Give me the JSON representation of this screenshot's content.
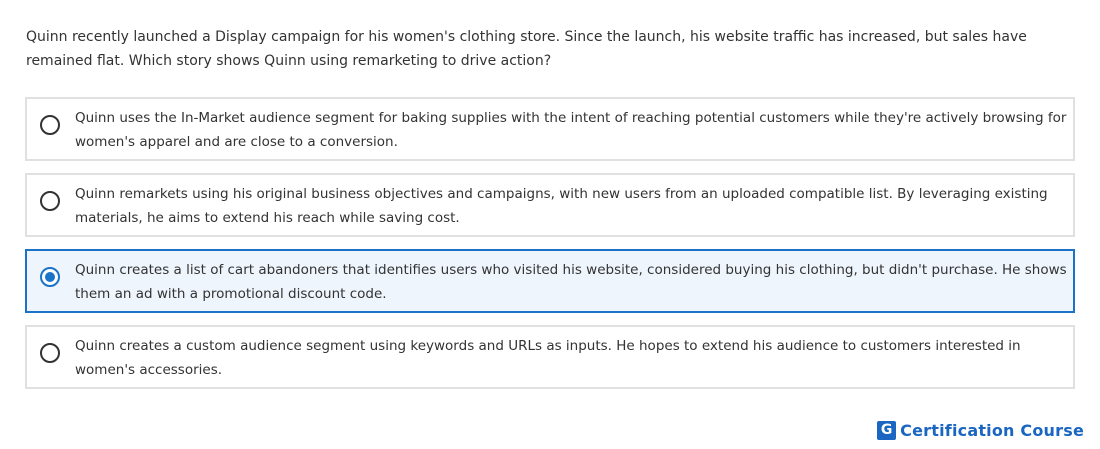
{
  "question": {
    "text": "Quinn recently launched a Display campaign for his women's clothing store. Since the launch, his website traffic has increased, but sales have remained flat. Which story shows Quinn using remarketing to drive action?"
  },
  "options": [
    {
      "text": "Quinn uses the In-Market audience segment for baking supplies with the intent of reaching potential customers while they're actively browsing for women's apparel and are close to a conversion.",
      "selected": false
    },
    {
      "text": "Quinn remarkets using his original business objectives and campaigns, with new users from an uploaded compatible list. By leveraging existing materials, he aims to extend his reach while saving cost.",
      "selected": false
    },
    {
      "text": "Quinn creates a list of cart abandoners that identifies users who visited his website, considered buying his clothing, but didn't purchase. He shows them an ad with a promotional discount code.",
      "selected": true
    },
    {
      "text": "Quinn creates a custom audience segment using keywords and URLs as inputs. He hopes to extend his audience to customers interested in women's accessories.",
      "selected": false
    }
  ],
  "brand": {
    "logo_letter": "G",
    "name": "Certification Course"
  },
  "colors": {
    "accent": "#1a73c8",
    "brand": "#1a66c2",
    "selected_bg": "#eef5fd",
    "border": "#e0e0e0"
  }
}
